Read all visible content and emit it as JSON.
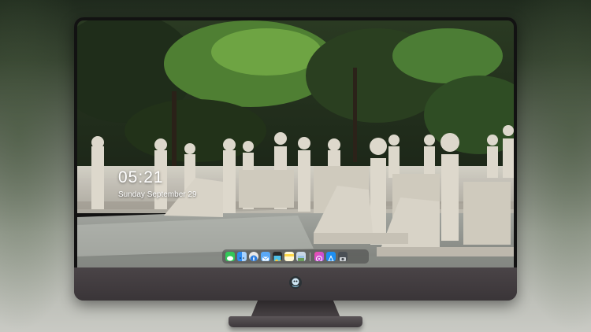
{
  "lock_screen": {
    "time": "05:21",
    "date": "Sunday September 29"
  },
  "dock": {
    "apps": [
      {
        "icon": "messages-icon",
        "color": "#34c759"
      },
      {
        "icon": "finder-icon",
        "color": "#2f8cf0"
      },
      {
        "icon": "safari-icon",
        "color": "#e8e8e8"
      },
      {
        "icon": "mail-icon",
        "color": "#5aa8f5"
      },
      {
        "icon": "photos-icon",
        "color": "#f0c23b"
      },
      {
        "icon": "notes-icon",
        "color": "#ffd84a"
      },
      {
        "icon": "preview-icon",
        "color": "#c9d7e6"
      },
      {
        "icon": "itunes-icon",
        "color": "#ee4fa7"
      },
      {
        "icon": "app-store-icon",
        "color": "#1e8ff3"
      },
      {
        "icon": "camera-icon",
        "color": "#9aa0a6"
      }
    ]
  }
}
